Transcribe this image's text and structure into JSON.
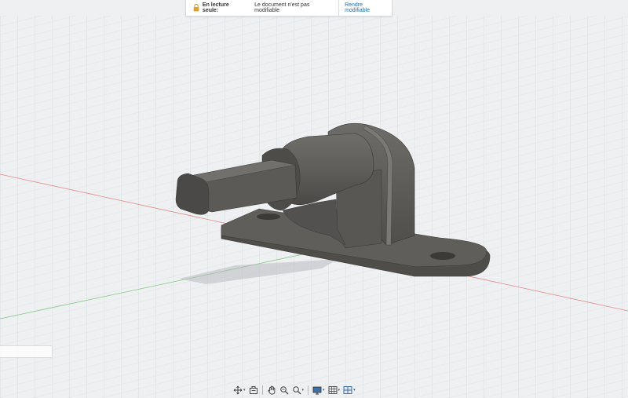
{
  "banner": {
    "title": "En lecture seule:",
    "message": "Le document n'est pas modifiable",
    "action": "Rendre modifiable",
    "icon": "lock-icon"
  },
  "colors": {
    "background": "#eef0f2",
    "grid": "#d3d6da",
    "x_axis": "#e08a8a",
    "y_axis": "#86c486",
    "model": "#5a5956",
    "link": "#1b6fb3",
    "lock": "#e0a22a"
  },
  "toolbar": {
    "items": [
      {
        "icon": "orbit-icon",
        "has_menu": true
      },
      {
        "icon": "look-at-icon",
        "has_menu": false
      },
      {
        "icon": "pan-icon",
        "has_menu": false
      },
      {
        "icon": "zoom-icon",
        "has_menu": false
      },
      {
        "icon": "fit-icon",
        "has_menu": true
      },
      {
        "icon": "display-settings-icon",
        "has_menu": true
      },
      {
        "icon": "grid-icon",
        "has_menu": true
      },
      {
        "icon": "viewports-icon",
        "has_menu": true
      }
    ]
  }
}
